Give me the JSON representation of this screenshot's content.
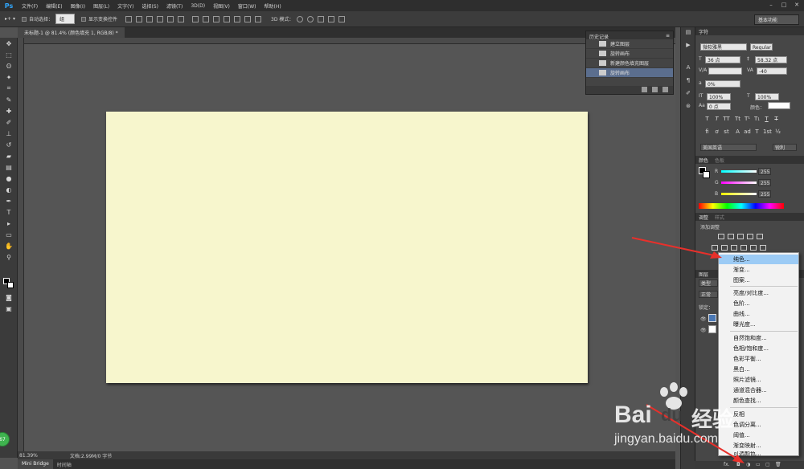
{
  "menubar": {
    "logo": "Ps",
    "items": [
      "文件(F)",
      "编辑(E)",
      "图像(I)",
      "图层(L)",
      "文字(Y)",
      "选择(S)",
      "滤镜(T)",
      "3D(D)",
      "视图(V)",
      "窗口(W)",
      "帮助(H)"
    ]
  },
  "options": {
    "auto_select_label": "自动选择：",
    "auto_select_value": "组",
    "show_transform_label": "显示变换控件",
    "mode_3d_label": "3D 模式：",
    "workspace": "基本功能"
  },
  "document": {
    "tab_title": "未标题-1 @ 81.4% (颜色填充 1, RGB/8) *",
    "zoom": "81.39%",
    "doc_info": "文档:2.99M/0 字节",
    "canvas_color": "#f7f6cd"
  },
  "bottom_tabs": [
    "Mini Bridge",
    "时间轴"
  ],
  "history": {
    "title": "历史记录",
    "rows": [
      "建立图层",
      "旋转画布",
      "新建颜色填充图层",
      "旋转画布"
    ]
  },
  "character": {
    "tab": "字符",
    "font_family": "微软雅黑",
    "font_style": "Regular",
    "size": "36 点",
    "leading": "58.32 点",
    "tracking": "-40",
    "scale_label": "0%",
    "vscale": "100%",
    "hscale": "100%",
    "baseline": "0 点",
    "color_label": "颜色：",
    "language": "美国英语",
    "aa": "锐利"
  },
  "color_panel": {
    "tabs": [
      "颜色",
      "色板"
    ],
    "channels": [
      {
        "name": "R",
        "value": "255"
      },
      {
        "name": "G",
        "value": "255"
      },
      {
        "name": "B",
        "value": "255"
      }
    ]
  },
  "adjustments": {
    "tabs": [
      "调整",
      "样式"
    ],
    "add_label": "添加调整"
  },
  "layers": {
    "tabs": [
      "图层"
    ],
    "kind": "类型",
    "mode": "正常",
    "lock_label": "锁定："
  },
  "context_menu": {
    "items": [
      "纯色...",
      "渐变...",
      "图案...",
      "亮度/对比度...",
      "色阶...",
      "曲线...",
      "曝光度...",
      "自然饱和度...",
      "色相/饱和度...",
      "色彩平衡...",
      "黑白...",
      "照片滤镜...",
      "通道混合器...",
      "颜色查找...",
      "反相",
      "色调分离...",
      "阈值...",
      "渐变映射...",
      "可选颜色..."
    ],
    "highlight_index": 0
  },
  "badge": "67",
  "watermark": {
    "brand": "Bai",
    "brand2": "du",
    "cn": "经验",
    "url": "jingyan.baidu.com"
  }
}
